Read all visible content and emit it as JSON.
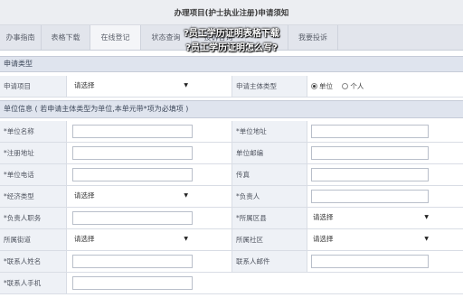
{
  "header": {
    "title": "办理项目(护士执业注册)申请须知"
  },
  "tabs": [
    {
      "label": "办事指南"
    },
    {
      "label": "表格下载"
    },
    {
      "label": "在线登记"
    },
    {
      "label": "状态查询"
    },
    {
      "label": "投诉咨询"
    },
    {
      "label": "我要投诉"
    }
  ],
  "overlay": {
    "line1": "?员工学历证明表格下载",
    "line2": "?员工学历证明怎么写?"
  },
  "sections": {
    "apply_type": "申请类型",
    "unit_info": "单位信息 ( 若申请主体类型为单位,本单元带*项为必填项 )"
  },
  "apply_row": {
    "item_label": "申请项目",
    "item_select": "请选择",
    "subject_label": "申请主体类型",
    "options": [
      "单位",
      "个人"
    ],
    "selected": "单位"
  },
  "fields": {
    "unit_name": "*单位名称",
    "unit_address": "*单位地址",
    "reg_address": "*注册地址",
    "unit_postcode": "单位邮编",
    "unit_phone": "*单位电话",
    "fax": "传真",
    "econ_type": "*经济类型",
    "econ_select": "请选择",
    "legal_person": "*负责人",
    "legal_duty": "*负责人职务",
    "district": "*所属区县",
    "district_select": "请选择",
    "street": "所属街道",
    "street_select": "请选择",
    "community": "所属社区",
    "community_select": "请选择",
    "contact_name": "*联系人姓名",
    "contact_email": "联系人邮件",
    "contact_mobile": "*联系人手机"
  }
}
